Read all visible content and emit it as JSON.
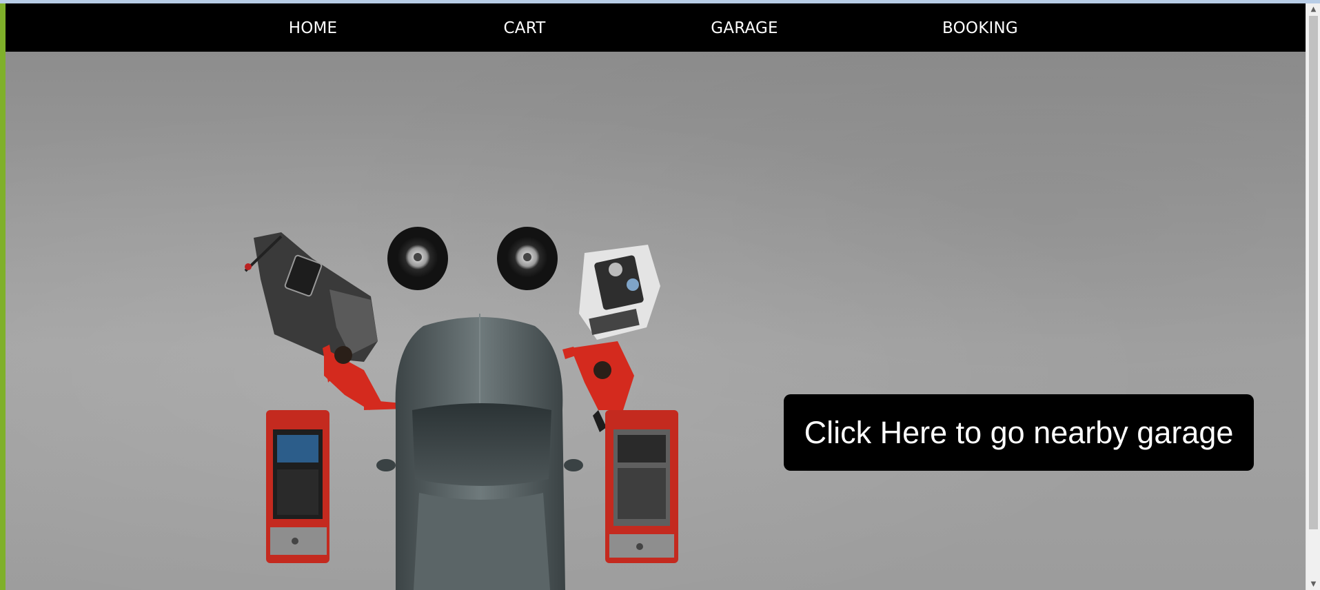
{
  "nav": {
    "items": [
      {
        "label": "HOME"
      },
      {
        "label": "CART"
      },
      {
        "label": "GARAGE"
      },
      {
        "label": "BOOKING"
      }
    ]
  },
  "hero": {
    "image_icon": "garage-service-illustration",
    "cta_label": "Click Here to go nearby garage"
  },
  "colors": {
    "navbar": "#000000",
    "cta_background": "#000000",
    "cta_text": "#ffffff",
    "accent_red": "#d42a1e",
    "page_background": "#9a9a9a"
  },
  "scrollbar": {
    "up_icon": "scroll-up-arrow-icon",
    "down_icon": "scroll-down-arrow-icon"
  }
}
